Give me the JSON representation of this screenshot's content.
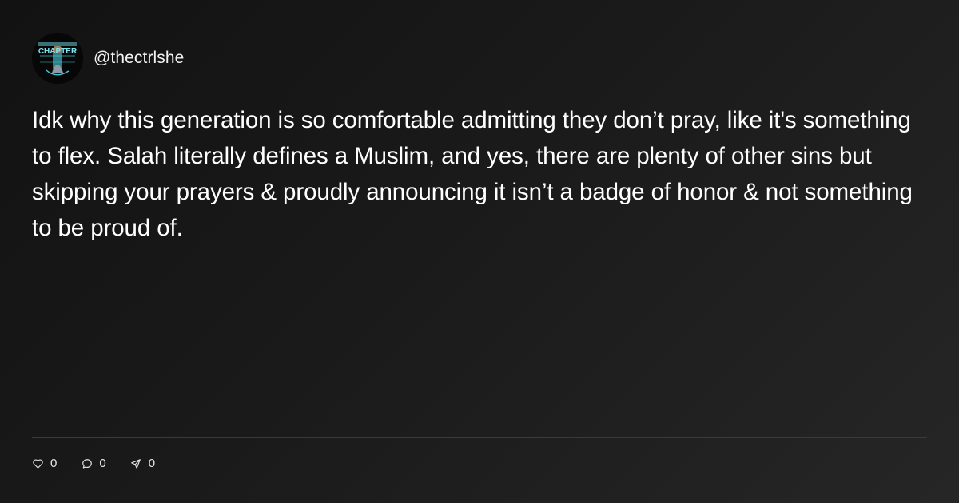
{
  "author": {
    "username": "@thectrlshe",
    "avatar_icon": "profile-picture",
    "avatar_text": "CHAPTER"
  },
  "post": {
    "text": "Idk why this generation is so comfortable admitting they don’t pray, like it's something to flex. Salah literally defines a Muslim, and yes, there are plenty of other sins but skipping your prayers & proudly announcing it isn’t a badge of honor & not something to be proud of."
  },
  "actions": {
    "likes": {
      "icon": "heart-icon",
      "count": "0"
    },
    "comments": {
      "icon": "comment-icon",
      "count": "0"
    },
    "shares": {
      "icon": "send-icon",
      "count": "0"
    }
  },
  "colors": {
    "background_dark": "#121212",
    "background_light": "#262626",
    "text": "#ffffff",
    "divider": "#3a3a3a",
    "avatar_accent": "#3ec6d6"
  }
}
